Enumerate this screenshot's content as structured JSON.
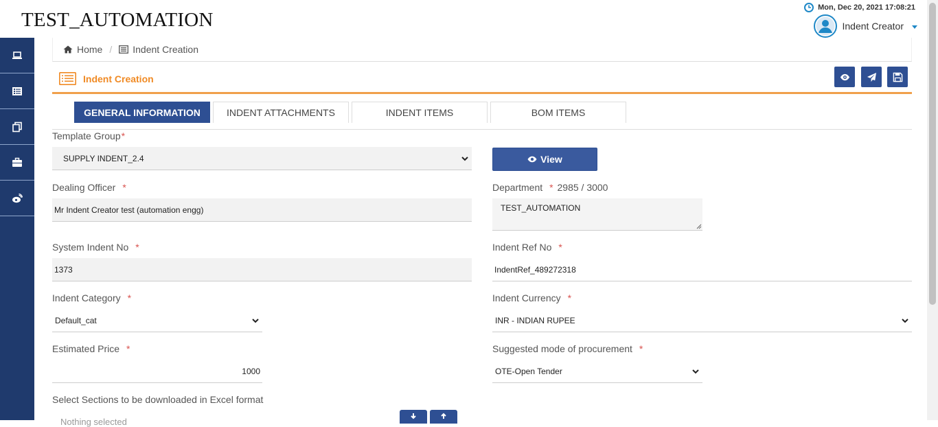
{
  "app": {
    "title": "TEST_AUTOMATION",
    "datetime": "Mon, Dec 20, 2021 17:08:21",
    "user": "Indent Creator"
  },
  "sidebar": {
    "icons": [
      "laptop-icon",
      "list-icon",
      "copy-icon",
      "briefcase-icon",
      "weibo-icon"
    ]
  },
  "breadcrumb": {
    "home": "Home",
    "current": "Indent Creation"
  },
  "panel": {
    "title": "Indent Creation"
  },
  "tabs": [
    "GENERAL INFORMATION",
    "INDENT ATTACHMENTS",
    "INDENT ITEMS",
    "BOM ITEMS"
  ],
  "form": {
    "template_group": {
      "label": "Template Group",
      "req": "*",
      "value": "SUPPLY INDENT_2.4"
    },
    "view_button": "View",
    "dealing_officer": {
      "label": "Dealing Officer",
      "req": "*",
      "value": "Mr Indent Creator test (automation engg)"
    },
    "department": {
      "label": "Department",
      "req": "*",
      "counter": "2985 / 3000",
      "value": "TEST_AUTOMATION"
    },
    "system_indent_no": {
      "label": "System Indent No",
      "req": "*",
      "value": "1373"
    },
    "indent_ref_no": {
      "label": "Indent Ref No",
      "req": "*",
      "value": "IndentRef_489272318"
    },
    "indent_category": {
      "label": "Indent Category",
      "req": "*",
      "value": "Default_cat"
    },
    "indent_currency": {
      "label": "Indent Currency",
      "req": "*",
      "value": "INR - INDIAN RUPEE"
    },
    "estimated_price": {
      "label": "Estimated Price",
      "req": "*",
      "value": "1000"
    },
    "procurement_mode": {
      "label": "Suggested mode of procurement",
      "req": "*",
      "value": "OTE-Open Tender"
    },
    "excel_sections": {
      "label": "Select Sections to be downloaded in Excel format",
      "placeholder": "Nothing selected"
    }
  },
  "colors": {
    "primary": "#2e4f93",
    "sidebar": "#1f3a6d",
    "accent": "#f08a24",
    "required": "#d9534f"
  }
}
